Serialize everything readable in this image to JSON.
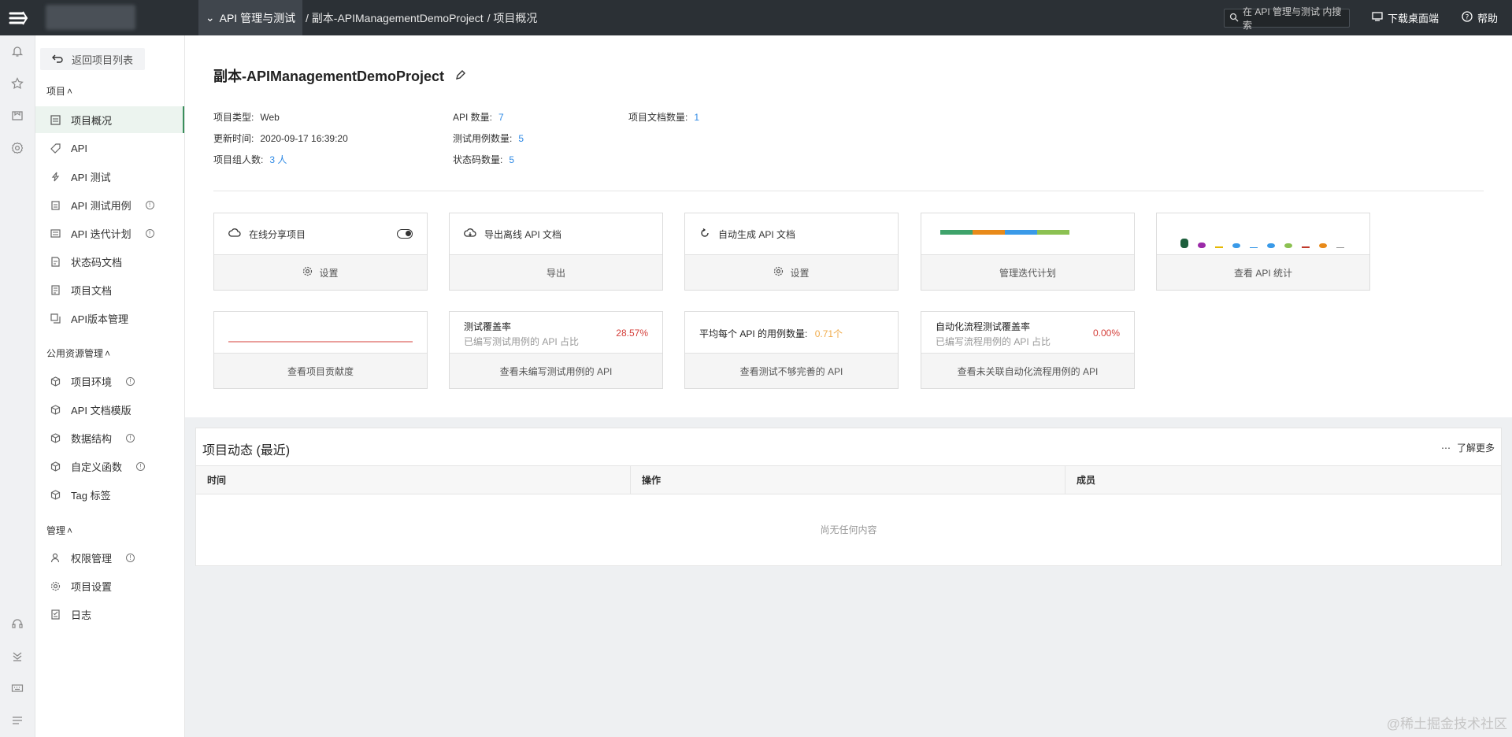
{
  "topbar": {
    "module_label": "API 管理与测试",
    "breadcrumb": [
      "/ 副本-APIManagementDemoProject",
      "/ 项目概况"
    ],
    "search_placeholder": "在 API 管理与测试 内搜索",
    "download_label": "下载桌面端",
    "help_label": "帮助"
  },
  "sidebar": {
    "back_label": "返回项目列表",
    "group_project": "项目",
    "project_items": [
      {
        "label": "项目概况"
      },
      {
        "label": "API"
      },
      {
        "label": "API 测试"
      },
      {
        "label": "API 测试用例"
      },
      {
        "label": "API 迭代计划"
      },
      {
        "label": "状态码文档"
      },
      {
        "label": "项目文档"
      },
      {
        "label": "API版本管理"
      }
    ],
    "group_public": "公用资源管理",
    "public_items": [
      {
        "label": "项目环境"
      },
      {
        "label": "API 文档模版"
      },
      {
        "label": "数据结构"
      },
      {
        "label": "自定义函数"
      },
      {
        "label": "Tag 标签"
      }
    ],
    "group_manage": "管理",
    "manage_items": [
      {
        "label": "权限管理"
      },
      {
        "label": "项目设置"
      },
      {
        "label": "日志"
      }
    ]
  },
  "project": {
    "title": "副本-APIManagementDemoProject",
    "type_label": "项目类型:",
    "type_value": "Web",
    "updated_label": "更新时间:",
    "updated_value": "2020-09-17 16:39:20",
    "members_label": "项目组人数:",
    "members_value": "3 人",
    "api_count_label": "API 数量:",
    "api_count_value": "7",
    "testcase_label": "测试用例数量:",
    "testcase_value": "5",
    "status_code_label": "状态码数量:",
    "status_code_value": "5",
    "doc_label": "项目文档数量:",
    "doc_value": "1"
  },
  "cards_row1": [
    {
      "title": "在线分享项目",
      "action": "设置"
    },
    {
      "title": "导出离线 API 文档",
      "action": "导出"
    },
    {
      "title": "自动生成 API 文档",
      "action": "设置"
    },
    {
      "title": "",
      "action": "管理迭代计划"
    },
    {
      "title": "",
      "action": "查看 API 统计"
    }
  ],
  "cards_row2": [
    {
      "title": "",
      "sub": "",
      "value": "",
      "action": "查看项目贡献度"
    },
    {
      "title": "测试覆盖率",
      "sub": "已编写测试用例的 API 占比",
      "value": "28.57%",
      "action": "查看未编写测试用例的 API"
    },
    {
      "title": "平均每个 API 的用例数量:",
      "sub": "",
      "value": "0.71个",
      "action": "查看测试不够完善的 API"
    },
    {
      "title": "自动化流程测试覆盖率",
      "sub": "已编写流程用例的 API 占比",
      "value": "0.00%",
      "action": "查看未关联自动化流程用例的 API"
    }
  ],
  "colors": {
    "accent": "#3a8f5c",
    "link": "#2f8ae5",
    "danger": "#d43f3a",
    "warning": "#f0ad4e",
    "iteration_bar": [
      "#3fa36b",
      "#e88a1a",
      "#3a9ae8",
      "#8cc152"
    ],
    "api_stats": [
      "#1d5e3c",
      "#9b2aa8",
      "#e6b800",
      "#3a9ae8",
      "#3a9ae8",
      "#3a9ae8",
      "#8cc152",
      "#c0392b",
      "#e88a1a",
      "#999999"
    ]
  },
  "activity": {
    "title": "项目动态 (最近)",
    "more_label": "了解更多",
    "columns": [
      "时间",
      "操作",
      "成员"
    ],
    "empty_text": "尚无任何内容"
  },
  "watermark": "@稀土掘金技术社区"
}
